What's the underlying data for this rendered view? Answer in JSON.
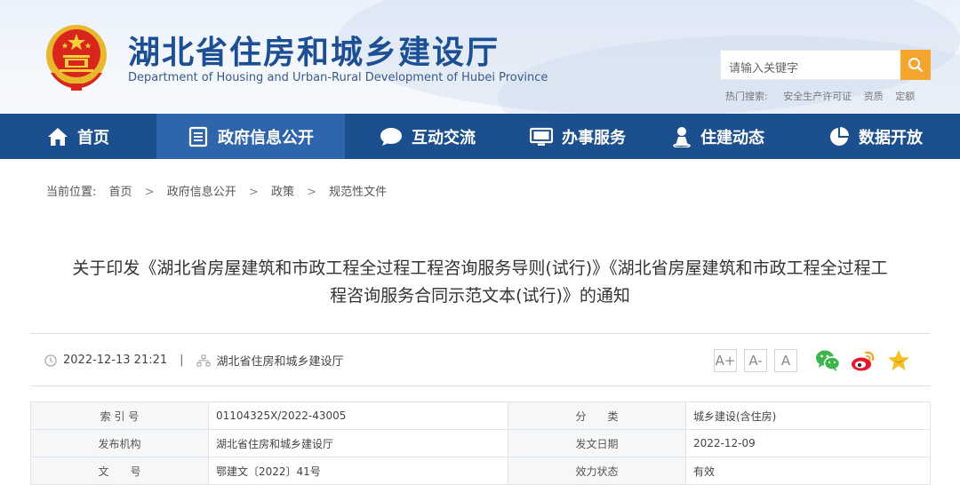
{
  "header": {
    "title": "湖北省住房和城乡建设厅",
    "subtitle": "Department of Housing and Urban-Rural Development of Hubei Province",
    "search_placeholder": "请输入关键字",
    "hot_label": "热门搜索:",
    "hot_terms": [
      "安全生产许可证",
      "资质",
      "定额"
    ],
    "accent": "#1c4f8e",
    "search_button_color": "#f4a52e"
  },
  "nav": {
    "items": [
      {
        "label": "首页",
        "icon": "home-icon"
      },
      {
        "label": "政府信息公开",
        "icon": "document-list-icon"
      },
      {
        "label": "互动交流",
        "icon": "chat-bubble-icon"
      },
      {
        "label": "办事服务",
        "icon": "monitor-icon"
      },
      {
        "label": "住建动态",
        "icon": "person-pin-icon"
      },
      {
        "label": "数据开放",
        "icon": "pie-chart-icon"
      }
    ],
    "active_index": 1
  },
  "breadcrumb": {
    "label": "当前位置:",
    "items": [
      "首页",
      "政府信息公开",
      "政策",
      "规范性文件"
    ],
    "separator": ">"
  },
  "article": {
    "title_line1": "关于印发《湖北省房屋建筑和市政工程全过程工程咨询服务导则(试行)》《湖北省房屋建筑和市政工程全过程工",
    "title_line2": "程咨询服务合同示范文本(试行)》的通知",
    "datetime": "2022-12-13 21:21",
    "divider": "|",
    "source": "湖北省住房和城乡建设厅",
    "font_buttons": [
      "A+",
      "A-",
      "A"
    ],
    "share_icons": [
      "wechat-icon",
      "weibo-icon",
      "favorite-star-icon"
    ]
  },
  "info_table": {
    "rows": [
      {
        "k1": "索 引 号",
        "v1": "01104325X/2022-43005",
        "k2": "分　　类",
        "v2": "城乡建设(含住房)"
      },
      {
        "k1": "发布机构",
        "v1": "湖北省住房和城乡建设厅",
        "k2": "发文日期",
        "v2": "2022-12-09"
      },
      {
        "k1": "文　　号",
        "v1": "鄂建文〔2022〕41号",
        "k2": "效力状态",
        "v2": "有效"
      }
    ]
  }
}
